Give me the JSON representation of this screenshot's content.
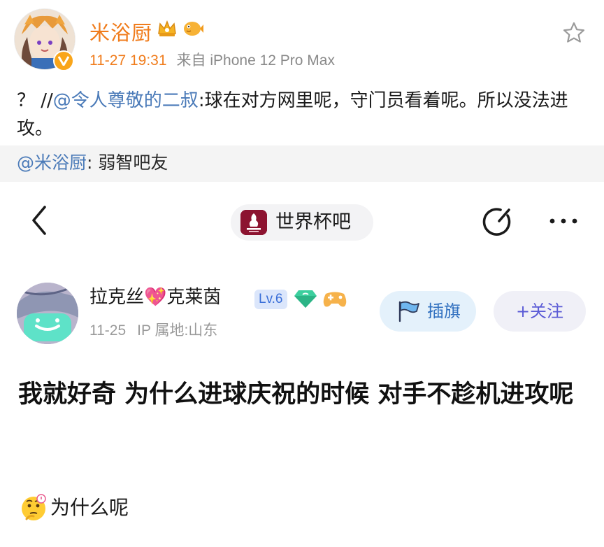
{
  "weibo": {
    "username": "米浴厨",
    "time": "11-27 19:31",
    "source": "来自 iPhone 12 Pro Max",
    "post": {
      "prefix": "？ //",
      "mention": "@令人尊敬的二叔",
      "text": ":球在对方网里呢，守门员看着呢。所以没法进攻。"
    },
    "repost": {
      "mention": "@米浴厨",
      "text": ": 弱智吧友"
    },
    "icons": {
      "star": "star-outline-icon",
      "verified": "verified-v-icon",
      "crown": "crown-badge-icon",
      "fish": "pufferfish-badge-icon"
    }
  },
  "forum": {
    "name": "世界杯吧",
    "author": {
      "name": "拉克丝💖克莱茵",
      "level": "Lv.6",
      "date": "11-25",
      "ip": "IP 属地:山东"
    },
    "buttons": {
      "flag": "插旗",
      "follow": "+关注"
    },
    "title": "我就好奇 为什么进球庆祝的时候 对手不趁机进攻呢",
    "body": "为什么呢",
    "icons": {
      "back": "chevron-left-icon",
      "edit": "edit-icon",
      "more": "more-dots-icon",
      "flag": "flag-icon",
      "gem": "gem-badge-icon",
      "gamepad": "gamepad-badge-icon",
      "thinking": "thinking-face-icon"
    }
  },
  "colors": {
    "weibo_orange": "#f07c1c",
    "mention_blue": "#4a7ab8",
    "repost_bg": "#f4f4f4",
    "flag_bg": "#e4f1fb",
    "follow_text": "#5b5bd6"
  }
}
